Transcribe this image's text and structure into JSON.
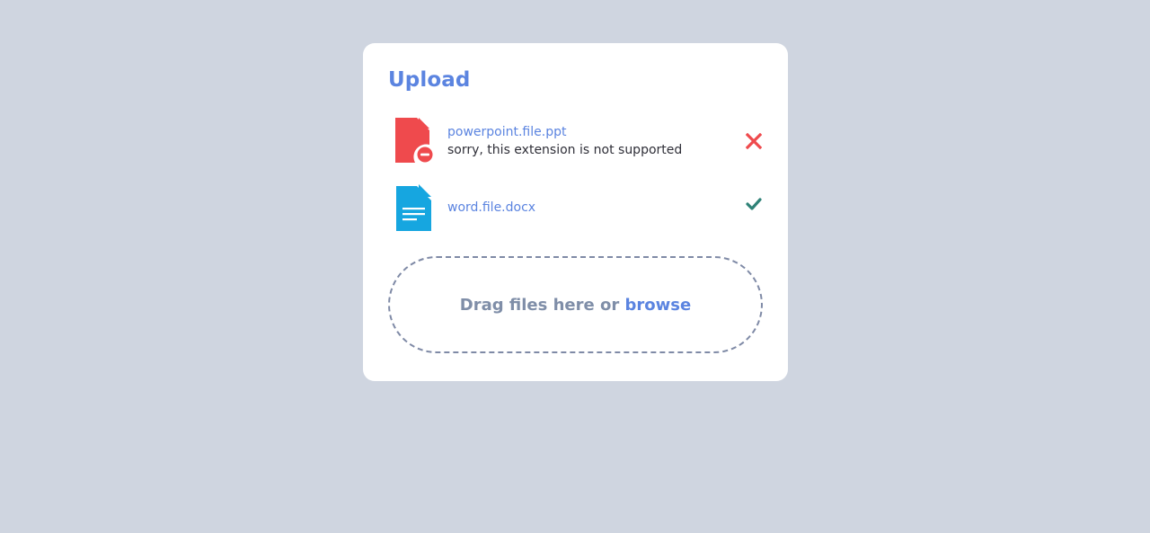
{
  "upload": {
    "title": "Upload",
    "files": [
      {
        "name": "powerpoint.file.ppt",
        "message": "sorry, this extension is not supported",
        "status": "error",
        "status_icon": "close-icon",
        "file_icon": "file-error-icon",
        "color": "#ef4a4d"
      },
      {
        "name": "word.file.docx",
        "message": "",
        "status": "success",
        "status_icon": "check-icon",
        "file_icon": "file-document-icon",
        "color": "#16a6e0"
      }
    ],
    "dropzone": {
      "prompt": "Drag files here or",
      "browse_label": "browse"
    }
  },
  "colors": {
    "background": "#cfd5e0",
    "card": "#ffffff",
    "accent": "#5b84e0",
    "error": "#ef4a4d",
    "success": "#2f8277",
    "dropzone_border": "#7f8aa6"
  }
}
